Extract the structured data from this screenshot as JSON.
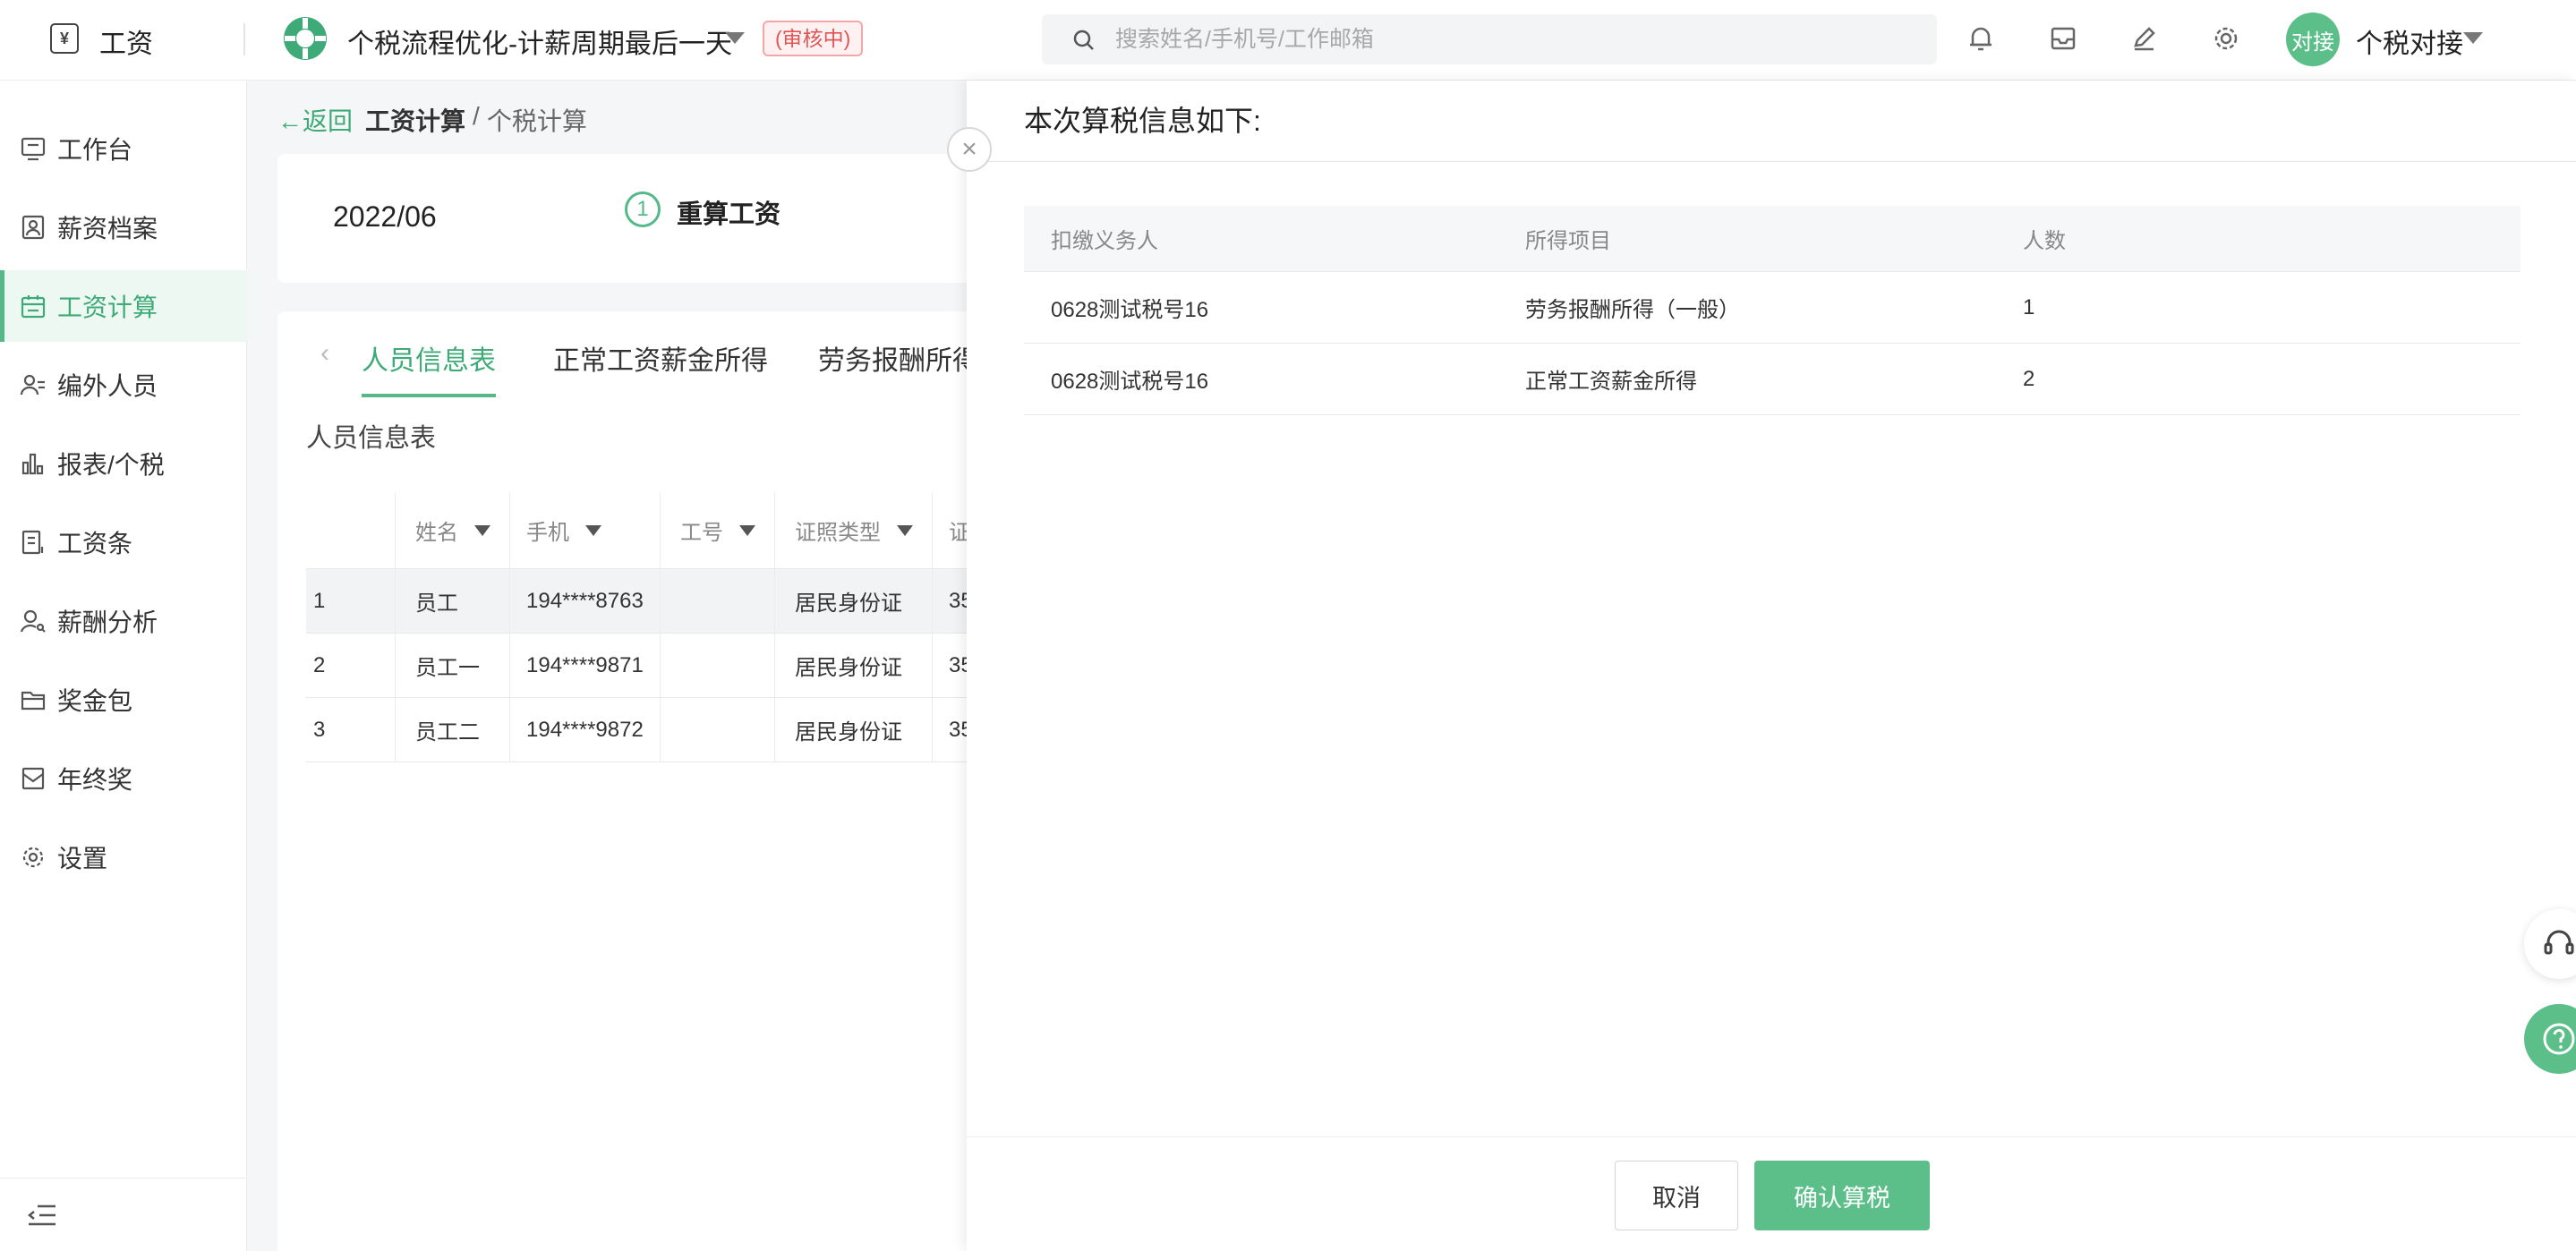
{
  "app": {
    "name": "工资",
    "logo_glyph": "¥"
  },
  "project": {
    "name": "个税流程优化-计薪周期最后一天",
    "status": "(审核中)"
  },
  "search": {
    "placeholder": "搜索姓名/手机号/工作邮箱"
  },
  "user": {
    "avatar_text": "对接",
    "name": "个税对接"
  },
  "sidebar": {
    "items": [
      {
        "label": "工作台",
        "icon": "desktop-icon"
      },
      {
        "label": "薪资档案",
        "icon": "profile-icon"
      },
      {
        "label": "工资计算",
        "icon": "calendar-icon",
        "active": true
      },
      {
        "label": "编外人员",
        "icon": "user-list-icon"
      },
      {
        "label": "报表/个税",
        "icon": "bar-chart-icon"
      },
      {
        "label": "工资条",
        "icon": "document-icon"
      },
      {
        "label": "薪酬分析",
        "icon": "user-search-icon"
      },
      {
        "label": "奖金包",
        "icon": "folder-icon"
      },
      {
        "label": "年终奖",
        "icon": "envelope-icon"
      },
      {
        "label": "设置",
        "icon": "gear-icon"
      }
    ]
  },
  "breadcrumb": {
    "back": "←返回",
    "current": "工资计算",
    "separator": "/",
    "sub": "个税计算"
  },
  "period": {
    "value": "2022/06",
    "step_number": "1",
    "step_label": "重算工资"
  },
  "tabs": [
    {
      "label": "人员信息表",
      "active": true
    },
    {
      "label": "正常工资薪金所得"
    },
    {
      "label": "劳务报酬所得"
    }
  ],
  "section_title": "人员信息表",
  "employee_table": {
    "headers": [
      "",
      "姓名",
      "手机",
      "工号",
      "证照类型",
      "证"
    ],
    "rows": [
      [
        "1",
        "员工",
        "194****8763",
        "",
        "居民身份证",
        "35"
      ],
      [
        "2",
        "员工一",
        "194****9871",
        "",
        "居民身份证",
        "35"
      ],
      [
        "3",
        "员工二",
        "194****9872",
        "",
        "居民身份证",
        "35"
      ]
    ]
  },
  "drawer": {
    "title": "本次算税信息如下:",
    "table": {
      "headers": [
        "扣缴义务人",
        "所得项目",
        "人数"
      ],
      "rows": [
        [
          "0628测试税号16",
          "劳务报酬所得（一般）",
          "1"
        ],
        [
          "0628测试税号16",
          "正常工资薪金所得",
          "2"
        ]
      ]
    },
    "cancel_label": "取消",
    "confirm_label": "确认算税"
  },
  "colors": {
    "accent": "#5cbf8a",
    "accent_text": "#3eaa77",
    "badge": "#e05656"
  }
}
